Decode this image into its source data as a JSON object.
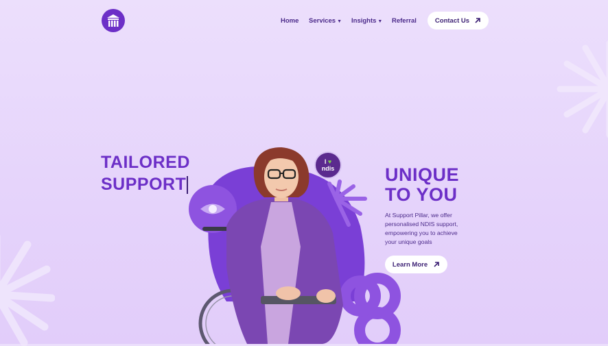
{
  "nav": {
    "home": "Home",
    "services": "Services",
    "insights": "Insights",
    "referral": "Referral",
    "contact": "Contact Us"
  },
  "hero": {
    "left_line1": "TAILORED",
    "left_line2": "SUPPORT",
    "right_line1": "UNIQUE",
    "right_line2": "TO YOU",
    "description": "At Support Pillar, we offer personalised NDIS support, empowering you to achieve your unique goals",
    "cta": "Learn More"
  },
  "badge": {
    "line1": "I",
    "line2": "ndis"
  },
  "colors": {
    "accent": "#6c2fc7",
    "text_dark": "#3b1f73",
    "background": "#e8d9fb"
  }
}
